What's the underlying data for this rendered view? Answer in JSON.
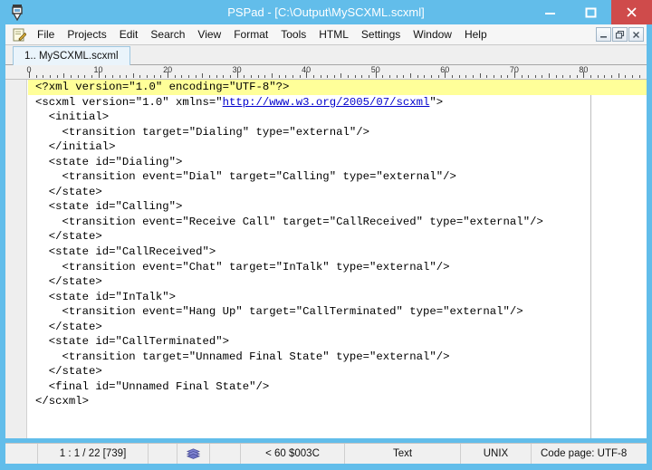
{
  "window": {
    "title": "PSPad - [C:\\Output\\MySCXML.scxml]",
    "app_icon_name": "pspad-pen-icon",
    "accent_color": "#62bdea",
    "close_color": "#cf4b4b",
    "caption_buttons": [
      {
        "name": "minimize",
        "glyph": "–"
      },
      {
        "name": "maximize",
        "glyph": "❐"
      },
      {
        "name": "close",
        "glyph": "×"
      }
    ]
  },
  "menu": {
    "doc_icon_name": "edit-document-icon",
    "items": [
      {
        "label": "File"
      },
      {
        "label": "Projects"
      },
      {
        "label": "Edit"
      },
      {
        "label": "Search"
      },
      {
        "label": "View"
      },
      {
        "label": "Format"
      },
      {
        "label": "Tools"
      },
      {
        "label": "HTML"
      },
      {
        "label": "Settings"
      },
      {
        "label": "Window"
      },
      {
        "label": "Help"
      }
    ],
    "mdi_buttons": [
      {
        "name": "mdi-minimize",
        "glyph": "–"
      },
      {
        "name": "mdi-restore",
        "glyph": "❐"
      },
      {
        "name": "mdi-close",
        "glyph": "✕"
      }
    ]
  },
  "tabs": [
    {
      "label": "1.. MySCXML.scxml",
      "active": true
    }
  ],
  "ruler": {
    "labels": [
      {
        "text": "0",
        "col": 0
      },
      {
        "text": "10",
        "col": 10
      },
      {
        "text": "20",
        "col": 20
      },
      {
        "text": "30",
        "col": 30
      },
      {
        "text": "40",
        "col": 40
      },
      {
        "text": "50",
        "col": 50
      },
      {
        "text": "60",
        "col": 60
      },
      {
        "text": "70",
        "col": 70
      },
      {
        "text": "80",
        "col": 80
      }
    ],
    "columns_visible": 88
  },
  "editor": {
    "highlight_color": "#ffff99",
    "link_color": "#0000cc",
    "caret_line": 1,
    "lines": [
      {
        "text": "<?xml version=\"1.0\" encoding=\"UTF-8\"?>",
        "highlight": true
      },
      {
        "text": "<scxml version=\"1.0\" xmlns=\"",
        "link": "http://www.w3.org/2005/07/scxml",
        "tail": "\">"
      },
      {
        "text": "  <initial>"
      },
      {
        "text": "    <transition target=\"Dialing\" type=\"external\"/>"
      },
      {
        "text": "  </initial>"
      },
      {
        "text": "  <state id=\"Dialing\">"
      },
      {
        "text": "    <transition event=\"Dial\" target=\"Calling\" type=\"external\"/>"
      },
      {
        "text": "  </state>"
      },
      {
        "text": "  <state id=\"Calling\">"
      },
      {
        "text": "    <transition event=\"Receive Call\" target=\"CallReceived\" type=\"external\"/>"
      },
      {
        "text": "  </state>"
      },
      {
        "text": "  <state id=\"CallReceived\">"
      },
      {
        "text": "    <transition event=\"Chat\" target=\"InTalk\" type=\"external\"/>"
      },
      {
        "text": "  </state>"
      },
      {
        "text": "  <state id=\"InTalk\">"
      },
      {
        "text": "    <transition event=\"Hang Up\" target=\"CallTerminated\" type=\"external\"/>"
      },
      {
        "text": "  </state>"
      },
      {
        "text": "  <state id=\"CallTerminated\">"
      },
      {
        "text": "    <transition target=\"Unnamed Final State\" type=\"external\"/>"
      },
      {
        "text": "  </state>"
      },
      {
        "text": "  <final id=\"Unnamed Final State\"/>"
      },
      {
        "text": "</scxml>"
      }
    ]
  },
  "status_bar": {
    "cursor_position": "1 : 1 / 22  [739]",
    "overwrite_icon_name": "layers-icon",
    "char_info": "<  60 $003C",
    "file_type": "Text",
    "line_endings": "UNIX",
    "code_page": "Code page: UTF-8"
  }
}
